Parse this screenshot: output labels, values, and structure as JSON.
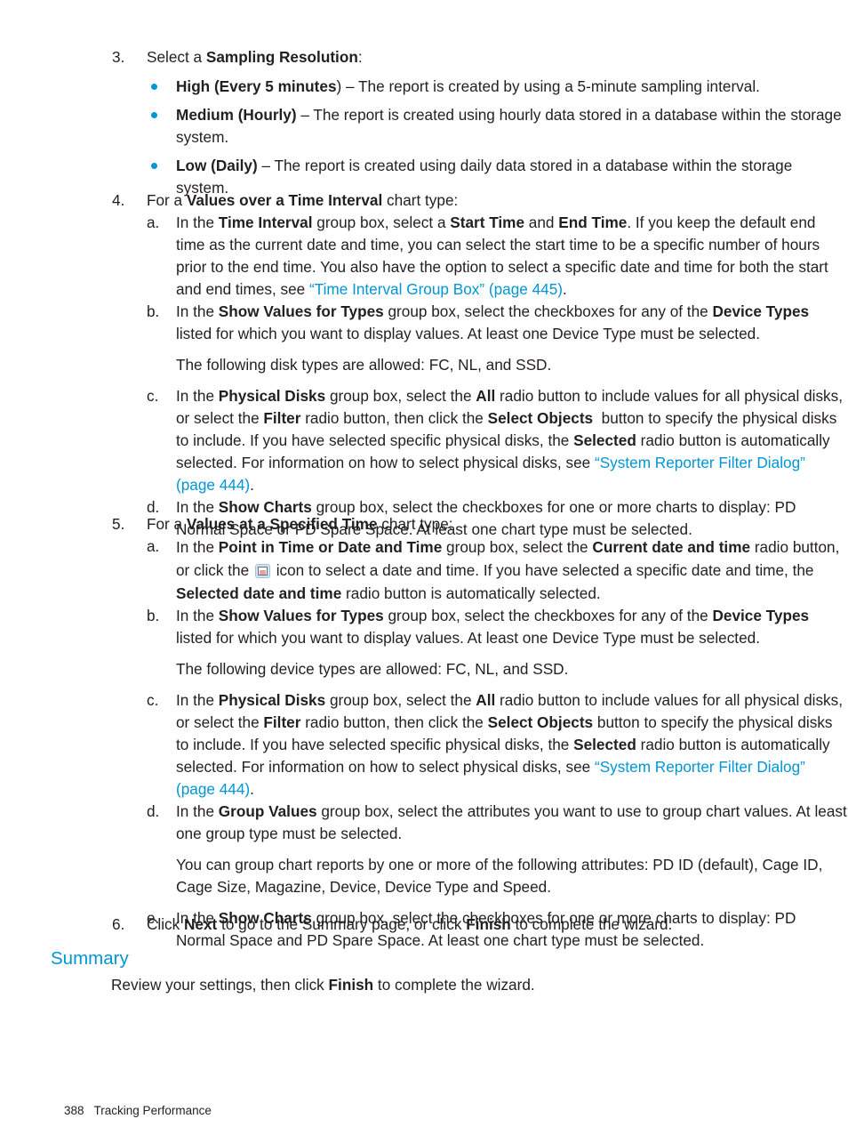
{
  "document": {
    "footer": {
      "page_number": "388",
      "chapter": "Tracking Performance"
    }
  },
  "steps": [
    {
      "number": "3.",
      "lead_before": "Select a ",
      "lead_bold": "Sampling Resolution",
      "lead_after": ":",
      "bullets": [
        {
          "bold": "High (Every 5 minutes",
          "text": ") – The report is created by using a 5-minute sampling interval."
        },
        {
          "bold": "Medium (Hourly)",
          "text": " – The report is created using hourly data stored in a database within the storage system."
        },
        {
          "bold": "Low (Daily)",
          "text": " – The report is created using daily data stored in a database within the storage system."
        }
      ]
    },
    {
      "number": "4.",
      "lead_before": "For a ",
      "lead_bold": "Values over a Time Interval",
      "lead_after": " chart type:"
    },
    {
      "number": "5.",
      "lead_before": "For a ",
      "lead_bold": "Values at a Specified Time",
      "lead_after": " chart type:"
    },
    {
      "number": "6.",
      "text_1": "Click ",
      "bold_1": "Next",
      "text_2": " to go to the Summary page, or click ",
      "bold_2": "Finish",
      "text_3": " to complete the wizard."
    }
  ],
  "step4_subitems": {
    "a": {
      "marker": "a.",
      "t1": "In the ",
      "b1": "Time Interval",
      "t2": " group box, select a ",
      "b2": "Start Time",
      "t3": " and ",
      "b3": "End Time",
      "t4": ". If you keep the default end time as the current date and time, you can select the start time to be a specific number of hours prior to the end time. You also have the option to select a specific date and time for both the start and end times, see ",
      "link": "“Time Interval Group Box” (page 445)",
      "t5": "."
    },
    "b": {
      "marker": "b.",
      "t1": "In the ",
      "b1": "Show Values for Types",
      "t2": " group box, select the checkboxes for any of the ",
      "b2": "Device Types",
      "t3": " listed for which you want to display values. At least one Device Type must be selected.",
      "note": "The following disk types are allowed: FC, NL, and SSD."
    },
    "c": {
      "marker": "c.",
      "t1": "In the ",
      "b1": "Physical Disks",
      "t2": " group box, select the ",
      "b2": "All",
      "t3": " radio button to include values for all physical disks, or select the ",
      "b3": "Filter",
      "t4": " radio button, then click the ",
      "b4": "Select Objects",
      "t5": "  button to specify the physical disks to include. If you have selected specific physical disks, the ",
      "b5": "Selected",
      "t6": " radio button is automatically selected. For information on how to select physical disks, see ",
      "link": "“System Reporter Filter Dialog” (page 444)",
      "t7": "."
    },
    "d": {
      "marker": "d.",
      "t1": "In the ",
      "b1": "Show Charts",
      "t2": " group box, select the checkboxes for one or more charts to display: PD Normal Space or PD Spare Space. At least one chart type must be selected."
    }
  },
  "step5_subitems": {
    "a": {
      "marker": "a.",
      "t1": "In the ",
      "b1": "Point in Time or Date and Time",
      "t2": " group box, select the ",
      "b2": "Current date and time",
      "t3": " radio button, or click the ",
      "icon": "calendar-date-picker-icon",
      "t4": " icon to select a date and time. If you have selected a specific date and time, the ",
      "b3": "Selected date and time",
      "t5": " radio button is automatically selected."
    },
    "b": {
      "marker": "b.",
      "t1": "In the ",
      "b1": "Show Values for Types",
      "t2": " group box, select the checkboxes for any of the ",
      "b2": "Device Types",
      "t3": " listed for which you want to display values. At least one Device Type must be selected.",
      "note": "The following device types are allowed: FC, NL, and SSD."
    },
    "c": {
      "marker": "c.",
      "t1": "In the ",
      "b1": "Physical Disks",
      "t2": " group box, select the ",
      "b2": "All",
      "t3": " radio button to include values for all physical disks, or select the ",
      "b3": "Filter",
      "t4": " radio button, then click the ",
      "b4": "Select Objects",
      "t5": " button to specify the physical disks to include. If you have selected specific physical disks, the ",
      "b5": "Selected",
      "t6": " radio button is automatically selected. For information on how to select physical disks, see ",
      "link": "“System Reporter Filter Dialog” (page 444)",
      "t7": "."
    },
    "d": {
      "marker": "d.",
      "t1": "In the ",
      "b1": "Group Values",
      "t2": " group box, select the attributes you want to use to group chart values. At least one group type must be selected.",
      "note": "You can group chart reports by one or more of the following attributes: PD ID (default), Cage ID, Cage Size, Magazine, Device, Device Type and Speed."
    },
    "e": {
      "marker": "e.",
      "t1": "In the ",
      "b1": "Show Charts",
      "t2": " group box, select the checkboxes for one or more charts to display: PD Normal Space and PD Spare Space. At least one chart type must be selected."
    }
  },
  "summary": {
    "heading": "Summary",
    "t1": "Review your settings, then click ",
    "b1": "Finish",
    "t2": " to complete the wizard."
  },
  "colors": {
    "link": "#0096d6",
    "heading": "#0096d6",
    "bullet": "#0096d6",
    "text": "#231f20",
    "background": "#ffffff"
  }
}
